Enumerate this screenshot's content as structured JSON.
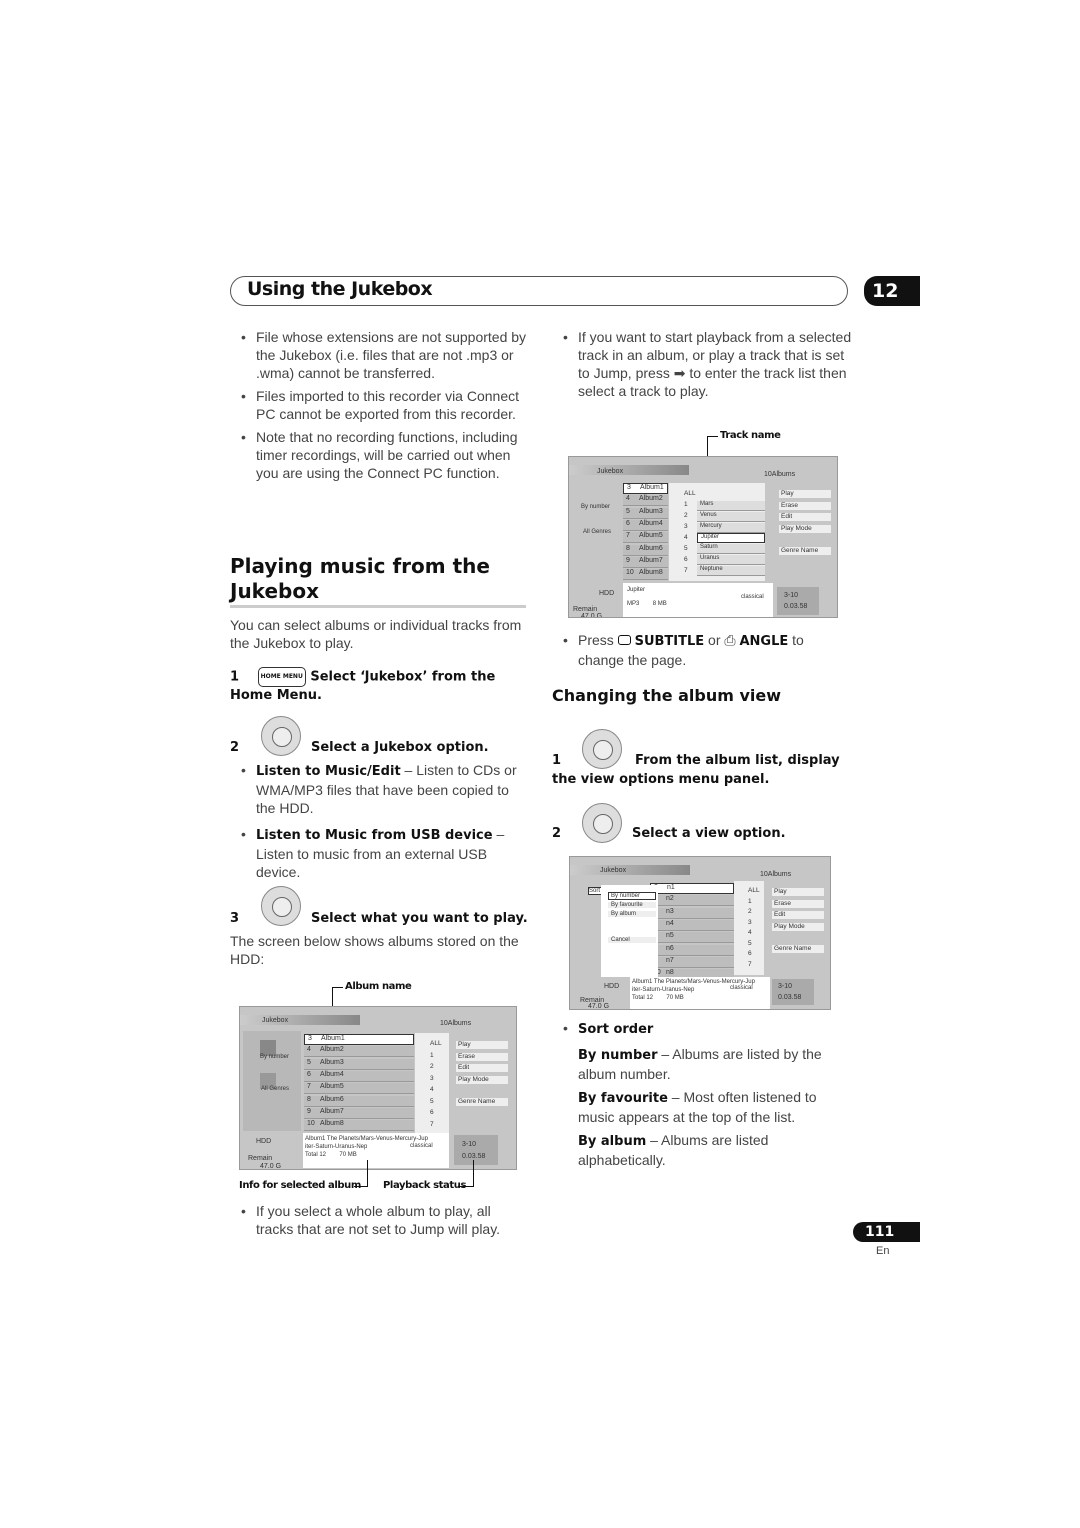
{
  "header": {
    "title": "Using the Jukebox",
    "chapter": "12"
  },
  "left": {
    "bullets": [
      "File whose extensions are not supported by the Jukebox (i.e. files that are not .mp3 or .wma) cannot be transferred.",
      "Files imported to this recorder via Connect PC cannot be exported from this recorder.",
      "Note that no recording functions, including timer recordings, will be carried out when you are using the Connect PC function."
    ],
    "section_title": "Playing music from the Jukebox",
    "intro": "You can select albums or individual tracks from the Jukebox to play.",
    "step1": {
      "num": "1",
      "button": "HOME MENU",
      "text": "Select ‘Jukebox’ from the Home Menu."
    },
    "step2": {
      "num": "2",
      "text": "Select a Jukebox option."
    },
    "options": [
      {
        "bold": "Listen to Music/Edit",
        "text": " – Listen to CDs or WMA/MP3 files that have been copied to the HDD."
      },
      {
        "bold": "Listen to Music from USB device",
        "text": " – Listen to music from an external USB device."
      }
    ],
    "step3": {
      "num": "3",
      "text": "Select what you want to play."
    },
    "step3_desc": "The screen below shows albums stored on the HDD:",
    "callouts": {
      "album_name": "Album name",
      "info": "Info for selected album",
      "playback": "Playback status"
    },
    "final_bullet": "If you select a whole album to play, all tracks that are not set to Jump will play."
  },
  "right": {
    "bullet1": "If you want to start playback from a selected track in an album, or play a track that is set to Jump, press ➡ to enter the track list then select a track to play.",
    "callout_track": "Track name",
    "press": {
      "a": "Press ",
      "subtitle": "SUBTITLE",
      "or": " or ",
      "angle": "ANGLE",
      "b": " to change the page."
    },
    "section_title": "Changing the album view",
    "step1": {
      "num": "1",
      "text": "From the album list, display the view options menu panel."
    },
    "step2": {
      "num": "2",
      "text": "Select a view option."
    },
    "sort_title": "Sort order",
    "sort_items": [
      {
        "bold": "By number",
        "text": " – Albums are listed by the album number."
      },
      {
        "bold": "By favourite",
        "text": " – Most often listened to music appears at the top of the list."
      },
      {
        "bold": "By album",
        "text": " – Albums are listed alphabetically."
      }
    ]
  },
  "screen": {
    "title": "Jukebox",
    "count": "10Albums",
    "sort": "By number",
    "genre": "All Genres",
    "albums": [
      [
        "3",
        "Album1"
      ],
      [
        "4",
        "Album2"
      ],
      [
        "5",
        "Album3"
      ],
      [
        "6",
        "Album4"
      ],
      [
        "7",
        "Album5"
      ],
      [
        "8",
        "Album6"
      ],
      [
        "9",
        "Album7"
      ],
      [
        "10",
        "Album8"
      ]
    ],
    "tracks": [
      "ALL",
      "1",
      "2",
      "3",
      "4",
      "5",
      "6",
      "7"
    ],
    "track_names": [
      [
        "1",
        "Mars"
      ],
      [
        "2",
        "Venus"
      ],
      [
        "3",
        "Mercury"
      ],
      [
        "4",
        "Jupiter"
      ],
      [
        "5",
        "Saturn"
      ],
      [
        "6",
        "Uranus"
      ],
      [
        "7",
        "Neptune"
      ]
    ],
    "menu": [
      "Play",
      "Erase",
      "Edit",
      "Play Mode",
      "Genre Name"
    ],
    "hdd": "HDD",
    "remain": "Remain",
    "remain_val": "47.0 G",
    "info1": "Album1  The Planets/Mars-Venus-Mercury-Jup",
    "info2": "iter-Saturn-Uranus-Nep",
    "info3": "Total 12",
    "info4": "70 MB",
    "genre_tag": "classical",
    "track_info": {
      "name": "Jupiter",
      "fmt": "MP3",
      "size": "8 MB"
    },
    "status1": "3-10",
    "status2": "0.03.58",
    "popup": [
      "By number",
      "By favourite",
      "By album",
      "Cancel"
    ],
    "sort_lbl": "Sort"
  },
  "footer": {
    "page": "111",
    "lang": "En"
  }
}
